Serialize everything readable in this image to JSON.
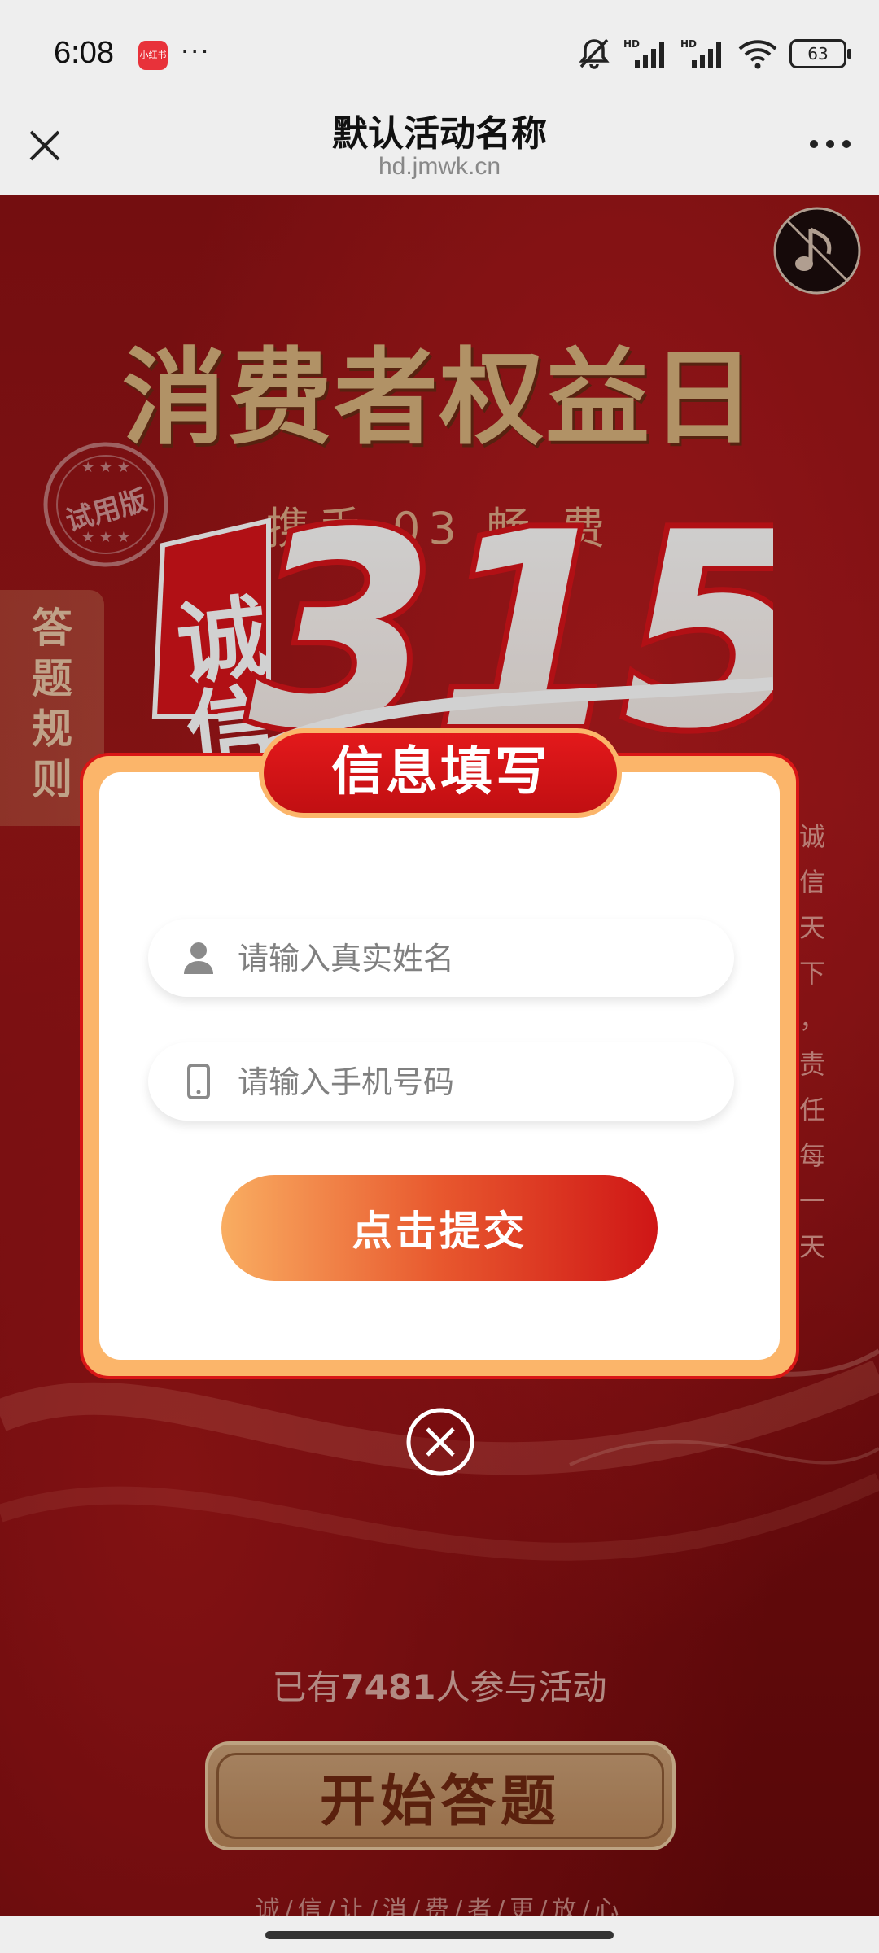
{
  "status_bar": {
    "time": "6:08",
    "app_badge": "小红书",
    "overflow": "···",
    "battery": "63"
  },
  "title_bar": {
    "title": "默认活动名称",
    "domain": "hd.jmwk.cn"
  },
  "poster": {
    "headline": "消费者权益日",
    "subline": "携手     03     畅     费",
    "stamp_text": "试用版",
    "logo_chars": "诚信",
    "logo_number": "315",
    "side_rules": [
      "答",
      "题",
      "规",
      "则"
    ],
    "side_text": [
      "诚",
      "信",
      "天",
      "下",
      "，",
      "责",
      "任",
      "每",
      "一",
      "天"
    ]
  },
  "modal": {
    "header": "信息填写",
    "name_placeholder": "请输入真实姓名",
    "phone_placeholder": "请输入手机号码",
    "submit_label": "点击提交"
  },
  "participants": {
    "prefix": "已有",
    "count": "7481",
    "suffix": "人参与活动"
  },
  "start_button": "开始答题",
  "slogan": "诚/信/让/消/费/者/更/放/心",
  "colors": {
    "primary_red": "#d91616",
    "accent_orange": "#fbb56a",
    "gold": "#d8b27d"
  }
}
